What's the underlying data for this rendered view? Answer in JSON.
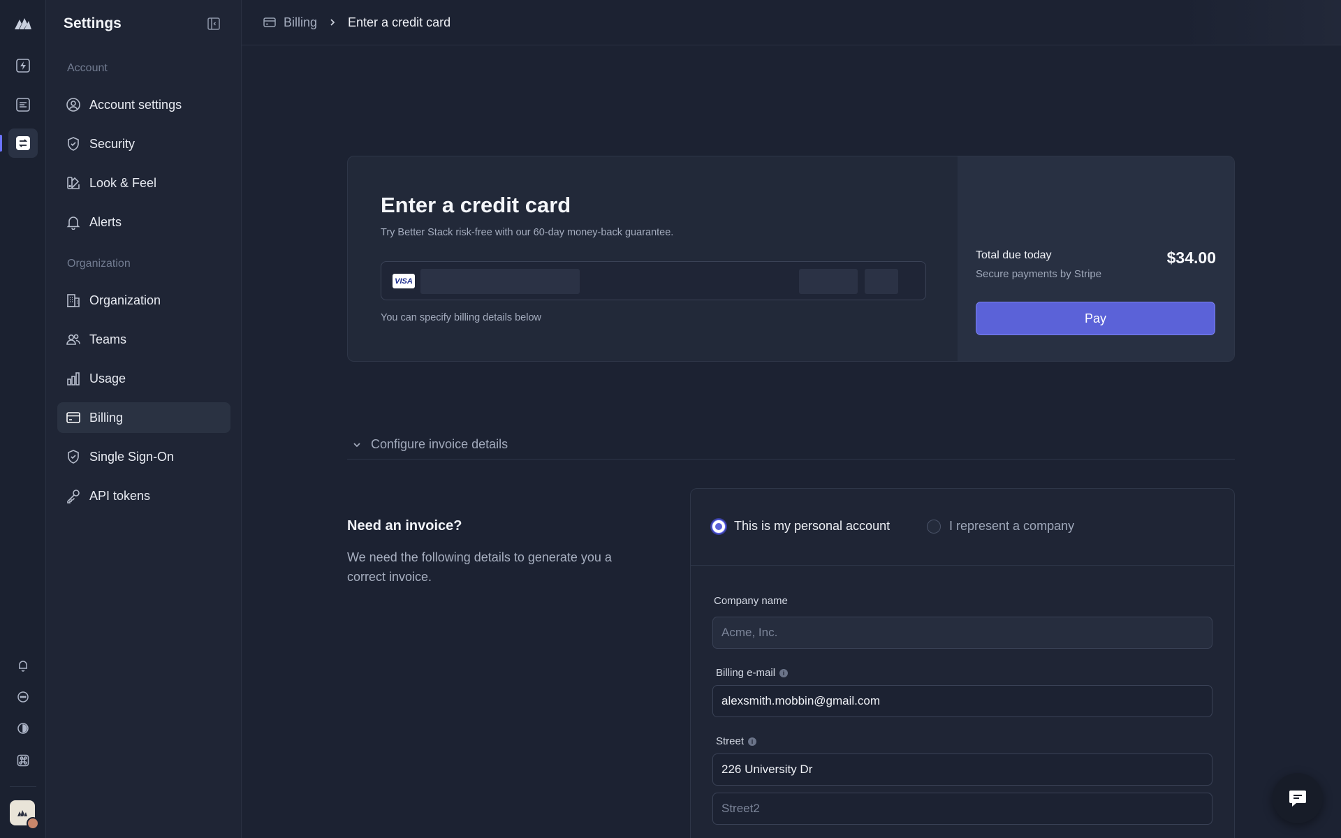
{
  "rail": {
    "items": [
      "logo-icon",
      "bolt-icon",
      "document-icon",
      "switch-icon",
      "bell-icon",
      "chat-icon",
      "half-circle-icon",
      "command-icon"
    ]
  },
  "sidebar": {
    "title": "Settings",
    "sections": {
      "account": "Account",
      "organization": "Organization"
    },
    "items": [
      {
        "label": "Account settings",
        "icon": "user-circle-icon"
      },
      {
        "label": "Security",
        "icon": "shield-check-icon"
      },
      {
        "label": "Look & Feel",
        "icon": "palette-icon"
      },
      {
        "label": "Alerts",
        "icon": "bell-icon"
      },
      {
        "label": "Organization",
        "icon": "building-icon"
      },
      {
        "label": "Teams",
        "icon": "users-icon"
      },
      {
        "label": "Usage",
        "icon": "bar-chart-icon"
      },
      {
        "label": "Billing",
        "icon": "credit-card-icon",
        "active": true
      },
      {
        "label": "Single Sign-On",
        "icon": "shield-check-icon"
      },
      {
        "label": "API tokens",
        "icon": "key-icon"
      }
    ]
  },
  "breadcrumb": {
    "parent": "Billing",
    "current": "Enter a credit card"
  },
  "payment": {
    "title": "Enter a credit card",
    "subtitle": "Try Better Stack risk-free with our 60-day money-back guarantee.",
    "card_brand": "VISA",
    "hint": "You can specify billing details below",
    "total_label": "Total due today",
    "secure_label": "Secure payments by Stripe",
    "amount": "$34.00",
    "pay_label": "Pay"
  },
  "invoice": {
    "accordion_label": "Configure invoice details",
    "title": "Need an invoice?",
    "description": "We need the following details to generate you a correct invoice.",
    "account_types": {
      "personal": "This is my personal account",
      "company": "I represent a company",
      "selected": "personal"
    },
    "fields": {
      "company_label": "Company name",
      "company_placeholder": "Acme, Inc.",
      "email_label": "Billing e-mail",
      "email_value": "alexsmith.mobbin@gmail.com",
      "street_label": "Street",
      "street_value": "226 University Dr",
      "street2_placeholder": "Street2"
    }
  },
  "colors": {
    "accent": "#5b62d8",
    "background": "#1c2232",
    "sidebar": "#1f2535"
  }
}
